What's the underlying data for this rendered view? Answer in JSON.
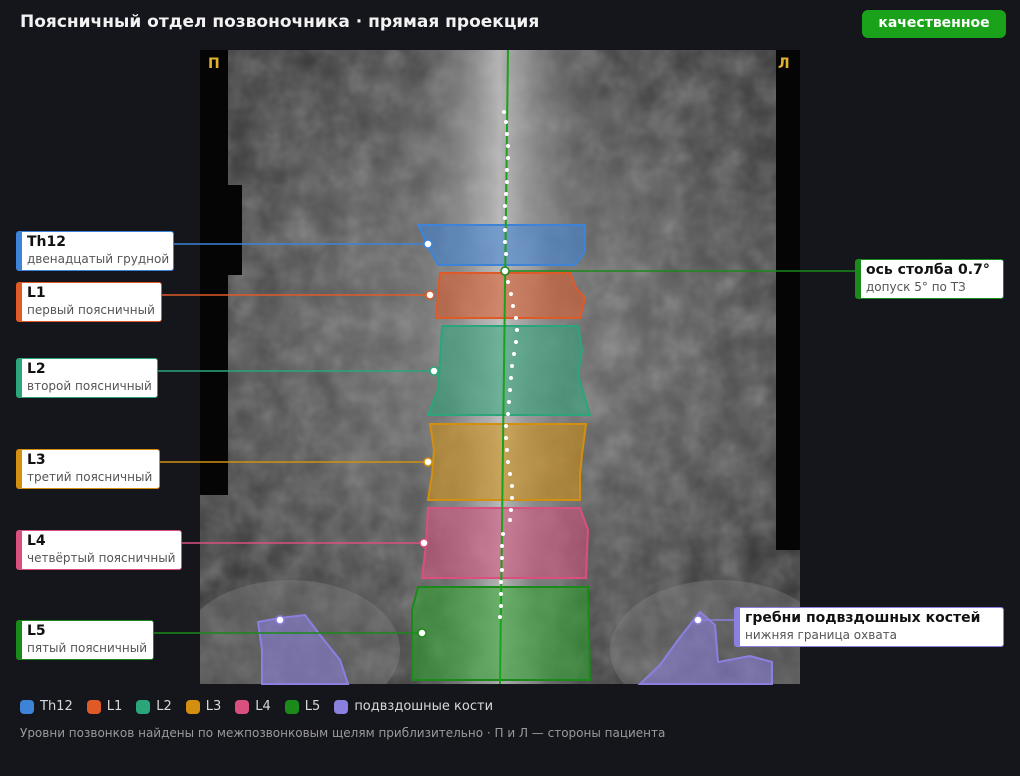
{
  "header": {
    "title": "Поясничный отдел позвоночника · прямая проекция",
    "quality_badge": "качественное",
    "quality_color": "#1aa31a"
  },
  "image": {
    "side_right": "П",
    "side_left": "Л"
  },
  "vertebrae": [
    {
      "code": "Th12",
      "name": "двенадцатый грудной",
      "color": "#3d84d9"
    },
    {
      "code": "L1",
      "name": "первый поясничный",
      "color": "#e05a28"
    },
    {
      "code": "L2",
      "name": "второй поясничный",
      "color": "#2aa67a"
    },
    {
      "code": "L3",
      "name": "третий поясничный",
      "color": "#d38f0f"
    },
    {
      "code": "L4",
      "name": "четвёртый поясничный",
      "color": "#d9507f"
    },
    {
      "code": "L5",
      "name": "пятый поясничный",
      "color": "#1a8a1a"
    }
  ],
  "axis": {
    "title": "ось столба 0.7°",
    "note": "допуск 5° по ТЗ",
    "color": "#1a8a1a"
  },
  "iliac": {
    "title": "гребни подвздошных костей",
    "note": "нижняя граница охвата",
    "color": "#8a80e0"
  },
  "legend": [
    {
      "label": "Th12",
      "color": "#3d84d9"
    },
    {
      "label": "L1",
      "color": "#e05a28"
    },
    {
      "label": "L2",
      "color": "#2aa67a"
    },
    {
      "label": "L3",
      "color": "#d38f0f"
    },
    {
      "label": "L4",
      "color": "#d9507f"
    },
    {
      "label": "L5",
      "color": "#1a8a1a"
    },
    {
      "label": "подвздошные кости",
      "color": "#8a80e0"
    }
  ],
  "footnote": "Уровни позвонков найдены по межпозвонковым щелям приблизительно · П и Л — стороны пациента"
}
